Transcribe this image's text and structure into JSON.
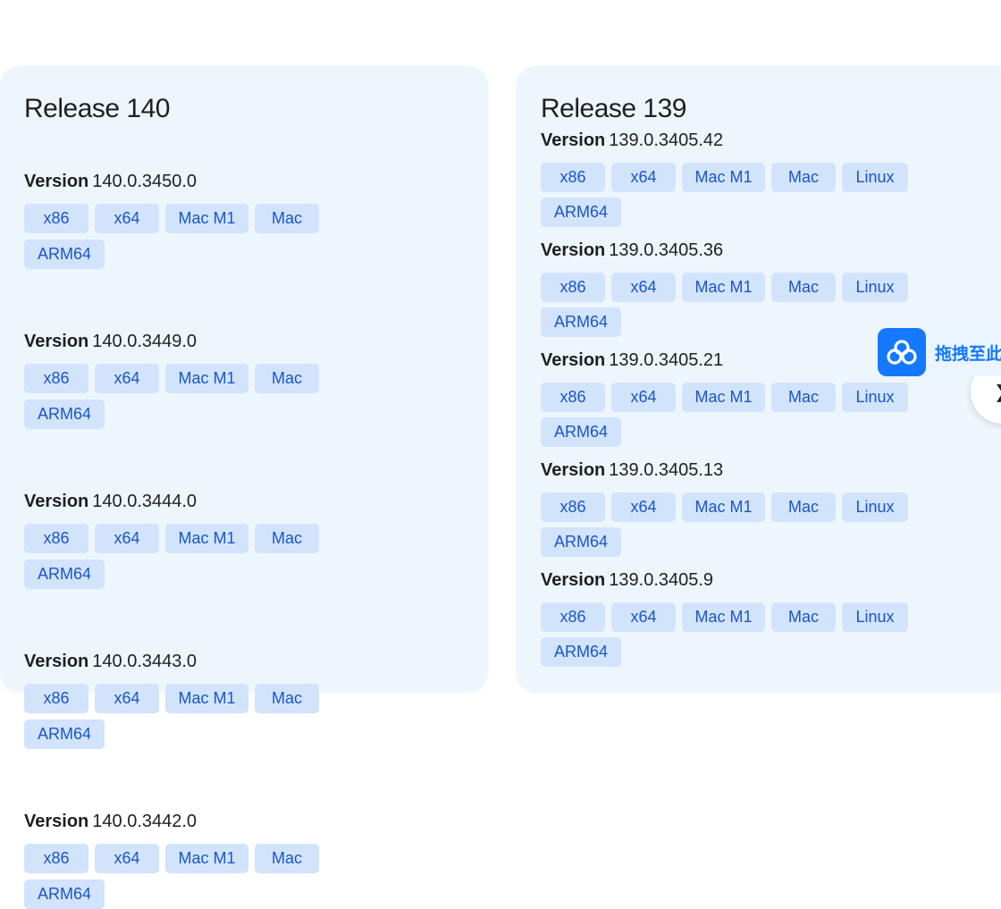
{
  "releases": [
    {
      "title": "Release 140",
      "versions": [
        {
          "label": "Version",
          "number": "140.0.3450.0",
          "chips": [
            "x86",
            "x64",
            "Mac M1",
            "Mac",
            "ARM64"
          ]
        },
        {
          "label": "Version",
          "number": "140.0.3449.0",
          "chips": [
            "x86",
            "x64",
            "Mac M1",
            "Mac",
            "ARM64"
          ]
        },
        {
          "label": "Version",
          "number": "140.0.3444.0",
          "chips": [
            "x86",
            "x64",
            "Mac M1",
            "Mac",
            "ARM64"
          ]
        },
        {
          "label": "Version",
          "number": "140.0.3443.0",
          "chips": [
            "x86",
            "x64",
            "Mac M1",
            "Mac",
            "ARM64"
          ]
        },
        {
          "label": "Version",
          "number": "140.0.3442.0",
          "chips": [
            "x86",
            "x64",
            "Mac M1",
            "Mac",
            "ARM64"
          ]
        }
      ]
    },
    {
      "title": "Release 139",
      "versions": [
        {
          "label": "Version",
          "number": "139.0.3405.42",
          "chips": [
            "x86",
            "x64",
            "Mac M1",
            "Mac",
            "Linux",
            "ARM64"
          ]
        },
        {
          "label": "Version",
          "number": "139.0.3405.36",
          "chips": [
            "x86",
            "x64",
            "Mac M1",
            "Mac",
            "Linux",
            "ARM64"
          ]
        },
        {
          "label": "Version",
          "number": "139.0.3405.21",
          "chips": [
            "x86",
            "x64",
            "Mac M1",
            "Mac",
            "Linux",
            "ARM64"
          ]
        },
        {
          "label": "Version",
          "number": "139.0.3405.13",
          "chips": [
            "x86",
            "x64",
            "Mac M1",
            "Mac",
            "Linux",
            "ARM64"
          ]
        },
        {
          "label": "Version",
          "number": "139.0.3405.9",
          "chips": [
            "x86",
            "x64",
            "Mac M1",
            "Mac",
            "Linux",
            "ARM64"
          ]
        }
      ]
    }
  ],
  "float_widget": {
    "icon": "cloud-icon",
    "text": "拖拽至此"
  },
  "colors": {
    "card_bg": "#eef6fd",
    "chip_bg": "#d2e3fc",
    "chip_text": "#1a56c8",
    "widget_accent": "#1479ff"
  }
}
